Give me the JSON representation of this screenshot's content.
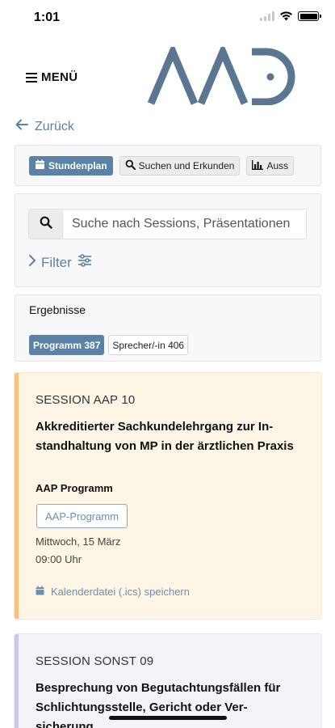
{
  "status_bar": {
    "time": "1:01"
  },
  "header": {
    "menu_label": "MENÜ"
  },
  "navigation": {
    "back_label": "Zurück"
  },
  "tabs": [
    {
      "label": "Stundenplan",
      "icon": "calendar-icon",
      "active": true
    },
    {
      "label": "Suchen und Erkunden",
      "icon": "search-icon",
      "active": false
    },
    {
      "label": "Auss",
      "icon": "bar-chart-icon",
      "active": false
    }
  ],
  "search": {
    "placeholder": "Suche nach Sessions, Präsentationen",
    "filter_label": "Filter"
  },
  "results": {
    "title": "Ergebnisse",
    "tabs": [
      {
        "label": "Programm 387",
        "active": true
      },
      {
        "label": "Sprecher/-in 406",
        "active": false
      }
    ]
  },
  "sessions": [
    {
      "code": "SESSION AAP 10",
      "title": "Akkreditierter Sachkundelehrgang zur In-standhaltung von MP in der ärztlichen Praxis",
      "program": "AAP Programm",
      "tag": "AAP-Programm",
      "date": "Mittwoch, 15 März",
      "time": "09:00 Uhr",
      "calendar_link": "Kalenderdatei (.ics) speichern"
    },
    {
      "code": "SESSION SONST 09",
      "title": "Besprechung von Begutachtungsfällen für Schlichtungsstelle, Gericht oder Ver-sicherung"
    }
  ],
  "colors": {
    "accent": "#5b82a6",
    "logo": "#5b7691",
    "session1_bg": "#fdf6e6",
    "session1_border": "#f4c27a",
    "session2_bg": "#f3f3f9",
    "session2_border": "#c6cae6"
  }
}
